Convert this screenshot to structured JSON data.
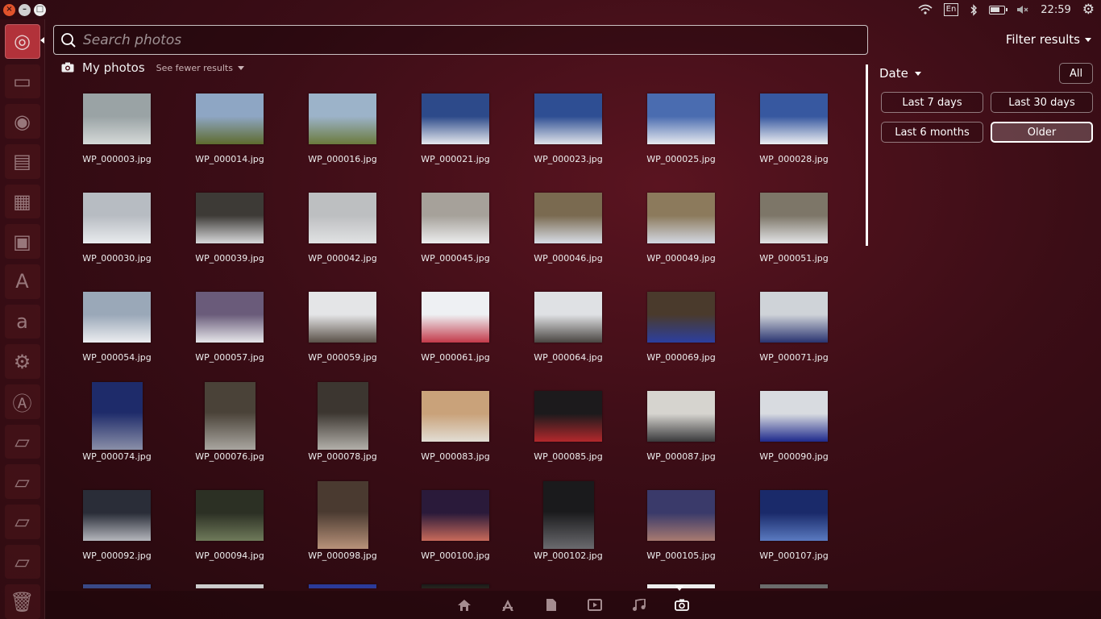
{
  "top_panel": {
    "time": "22:59",
    "keyboard": "En",
    "icons": [
      "wifi-icon",
      "keyboard-layout-icon",
      "bluetooth-icon",
      "battery-icon",
      "volume-muted-icon",
      "gear-icon"
    ]
  },
  "launcher": {
    "items": [
      {
        "name": "dash-home",
        "glyph": "◎",
        "active": true
      },
      {
        "name": "files",
        "glyph": "▭"
      },
      {
        "name": "firefox",
        "glyph": "◉"
      },
      {
        "name": "libreoffice-writer",
        "glyph": "▤"
      },
      {
        "name": "libreoffice-calc",
        "glyph": "▦"
      },
      {
        "name": "libreoffice-impress",
        "glyph": "▣"
      },
      {
        "name": "software-center",
        "glyph": "A"
      },
      {
        "name": "amazon",
        "glyph": "a"
      },
      {
        "name": "system-settings",
        "glyph": "⚙"
      },
      {
        "name": "software-updater",
        "glyph": "Ⓐ"
      },
      {
        "name": "drive-1",
        "glyph": "▱"
      },
      {
        "name": "drive-2",
        "glyph": "▱"
      },
      {
        "name": "drive-3",
        "glyph": "▱"
      },
      {
        "name": "drive-4",
        "glyph": "▱"
      },
      {
        "name": "trash",
        "glyph": "🗑"
      }
    ]
  },
  "search": {
    "placeholder": "Search photos",
    "value": ""
  },
  "filter_toggle_label": "Filter results",
  "category": {
    "title": "My photos",
    "more_label": "See fewer results"
  },
  "photos": [
    {
      "label": "WP_000003.jpg",
      "c1": "#9aa3a5",
      "c2": "#d5d9d8",
      "portrait": false
    },
    {
      "label": "WP_000014.jpg",
      "c1": "#8ea6c4",
      "c2": "#5e6b2e",
      "portrait": false
    },
    {
      "label": "WP_000016.jpg",
      "c1": "#9cb3c9",
      "c2": "#6b7a3c",
      "portrait": false
    },
    {
      "label": "WP_000021.jpg",
      "c1": "#2d4a8a",
      "c2": "#e5e8ee",
      "portrait": false
    },
    {
      "label": "WP_000023.jpg",
      "c1": "#2e4e93",
      "c2": "#dfe3ea",
      "portrait": false
    },
    {
      "label": "WP_000025.jpg",
      "c1": "#4a6cb0",
      "c2": "#e6e9ef",
      "portrait": false
    },
    {
      "label": "WP_000028.jpg",
      "c1": "#3758a0",
      "c2": "#eceef2",
      "portrait": false
    },
    {
      "label": "WP_000030.jpg",
      "c1": "#b7bcc2",
      "c2": "#e9ebee",
      "portrait": false
    },
    {
      "label": "WP_000039.jpg",
      "c1": "#3d3a36",
      "c2": "#d7d8da",
      "portrait": false
    },
    {
      "label": "WP_000042.jpg",
      "c1": "#bdbfc1",
      "c2": "#e1e2e3",
      "portrait": false
    },
    {
      "label": "WP_000045.jpg",
      "c1": "#a6a19a",
      "c2": "#ecedee",
      "portrait": false
    },
    {
      "label": "WP_000046.jpg",
      "c1": "#7a6a50",
      "c2": "#d8dde6",
      "portrait": false
    },
    {
      "label": "WP_000049.jpg",
      "c1": "#8c7a5c",
      "c2": "#d3d8e2",
      "portrait": false
    },
    {
      "label": "WP_000051.jpg",
      "c1": "#7d7668",
      "c2": "#e2e3e5",
      "portrait": false
    },
    {
      "label": "WP_000054.jpg",
      "c1": "#9aa8b8",
      "c2": "#ecedf0",
      "portrait": false
    },
    {
      "label": "WP_000057.jpg",
      "c1": "#6a5b7a",
      "c2": "#e6e6ea",
      "portrait": false
    },
    {
      "label": "WP_000059.jpg",
      "c1": "#e4e5e7",
      "c2": "#5a5148",
      "portrait": false
    },
    {
      "label": "WP_000061.jpg",
      "c1": "#eef0f3",
      "c2": "#c33a4a",
      "portrait": false
    },
    {
      "label": "WP_000064.jpg",
      "c1": "#dfe1e4",
      "c2": "#4a4642",
      "portrait": false
    },
    {
      "label": "WP_000069.jpg",
      "c1": "#4a3a2c",
      "c2": "#2c3fa0",
      "portrait": false
    },
    {
      "label": "WP_000071.jpg",
      "c1": "#cfd3d8",
      "c2": "#2a3470",
      "portrait": false
    },
    {
      "label": "WP_000074.jpg",
      "c1": "#1e2b6a",
      "c2": "#8a8fa8",
      "portrait": true
    },
    {
      "label": "WP_000076.jpg",
      "c1": "#4a4238",
      "c2": "#a9a6a0",
      "portrait": true
    },
    {
      "label": "WP_000078.jpg",
      "c1": "#3c3630",
      "c2": "#b3b0aa",
      "portrait": true
    },
    {
      "label": "WP_000083.jpg",
      "c1": "#c9a27a",
      "c2": "#e2ddd4",
      "portrait": false
    },
    {
      "label": "WP_000085.jpg",
      "c1": "#1c1a1c",
      "c2": "#b3282c",
      "portrait": false
    },
    {
      "label": "WP_000087.jpg",
      "c1": "#d6d4cf",
      "c2": "#3a3a3c",
      "portrait": false
    },
    {
      "label": "WP_000090.jpg",
      "c1": "#d8dbe0",
      "c2": "#1f2a8c",
      "portrait": false
    },
    {
      "label": "WP_000092.jpg",
      "c1": "#2a2d38",
      "c2": "#b4b6bc",
      "portrait": false
    },
    {
      "label": "WP_000094.jpg",
      "c1": "#2c3024",
      "c2": "#6f7a5a",
      "portrait": false
    },
    {
      "label": "WP_000098.jpg",
      "c1": "#4a3a30",
      "c2": "#b8927a",
      "portrait": true
    },
    {
      "label": "WP_000100.jpg",
      "c1": "#2a1a3a",
      "c2": "#c86a5a",
      "portrait": false
    },
    {
      "label": "WP_000102.jpg",
      "c1": "#1a1a1c",
      "c2": "#6a6a6e",
      "portrait": true
    },
    {
      "label": "WP_000105.jpg",
      "c1": "#3a3a6a",
      "c2": "#a87a70",
      "portrait": false
    },
    {
      "label": "WP_000107.jpg",
      "c1": "#1a2a6a",
      "c2": "#5a7ac0",
      "portrait": false
    }
  ],
  "partial_row": [
    {
      "c1": "#3a4a8a",
      "c2": "#2a2a3a"
    },
    {
      "c1": "#d0d0d0",
      "c2": "#6a6a6a"
    },
    {
      "c1": "#2a3a9a",
      "c2": "#4a4a8a"
    },
    {
      "c1": "#1a1a1a",
      "c2": "#c8b040"
    },
    null,
    {
      "c1": "#f0f0f0",
      "c2": "#c0c0c0"
    },
    {
      "c1": "#6a6a6a",
      "c2": "#8a8a8a"
    }
  ],
  "filters": {
    "date_label": "Date",
    "all_label": "All",
    "options": [
      {
        "label": "Last 7 days",
        "selected": false
      },
      {
        "label": "Last 30 days",
        "selected": false
      },
      {
        "label": "Last 6 months",
        "selected": false
      },
      {
        "label": "Older",
        "selected": true
      }
    ]
  },
  "lenses": [
    {
      "name": "home-lens-icon",
      "active": false
    },
    {
      "name": "applications-lens-icon",
      "active": false
    },
    {
      "name": "files-lens-icon",
      "active": false
    },
    {
      "name": "video-lens-icon",
      "active": false
    },
    {
      "name": "music-lens-icon",
      "active": false
    },
    {
      "name": "photos-lens-icon",
      "active": true
    }
  ]
}
